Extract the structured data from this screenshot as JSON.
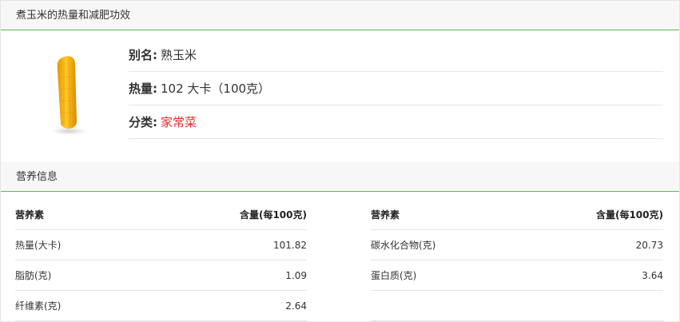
{
  "header": {
    "title": "煮玉米的热量和减肥功效"
  },
  "food_image": {
    "icon": "corn-image"
  },
  "info": {
    "alias_label": "别名:",
    "alias_value": "熟玉米",
    "calorie_label": "热量:",
    "calorie_value": "102 大卡（100克）",
    "category_label": "分类:",
    "category_value": "家常菜"
  },
  "nutrition": {
    "title": "营养信息",
    "headers": {
      "nutrient": "营养素",
      "amount": "含量(每100克)"
    },
    "rows": [
      {
        "left_name": "热量(大卡)",
        "left_value": "101.82",
        "right_name": "碳水化合物(克)",
        "right_value": "20.73"
      },
      {
        "left_name": "脂肪(克)",
        "left_value": "1.09",
        "right_name": "蛋白质(克)",
        "right_value": "3.64"
      },
      {
        "left_name": "纤维素(克)",
        "left_value": "2.64",
        "right_name": "",
        "right_value": ""
      }
    ]
  },
  "colors": {
    "accent_line": "#5cb85c",
    "category_red": "#e52b2b"
  }
}
